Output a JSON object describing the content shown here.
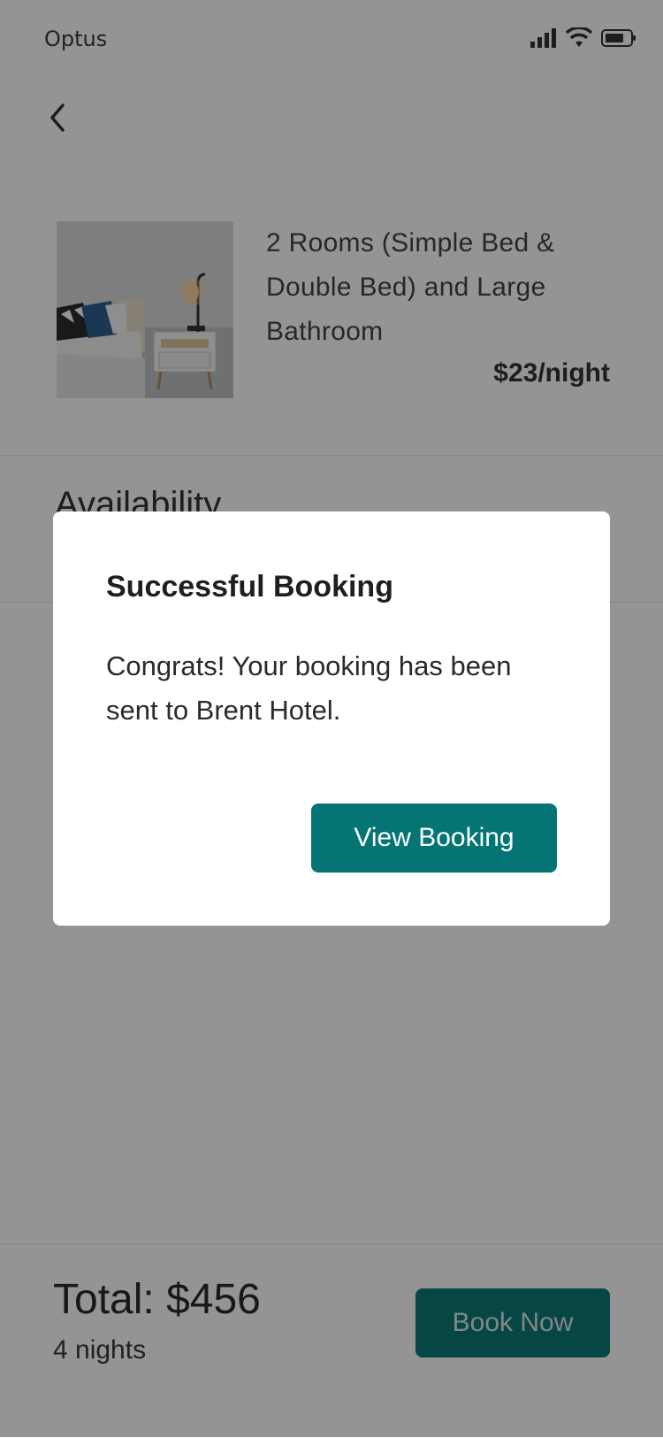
{
  "status_bar": {
    "carrier": "Optus",
    "icons": [
      "signal-icon",
      "wifi-icon",
      "battery-icon"
    ]
  },
  "header": {
    "back_icon": "chevron-left-icon"
  },
  "room": {
    "title": "2 Rooms (Simple Bed & Double Bed) and Large Bathroom",
    "price": "$23/night",
    "photo": "bedroom-photo"
  },
  "availability": {
    "heading": "Availability"
  },
  "footer": {
    "total": "Total: $456",
    "nights": "4 nights",
    "book_now_label": "Book Now"
  },
  "dialog": {
    "title": "Successful Booking",
    "message": "Congrats! Your booking has been sent to Brent Hotel.",
    "view_booking_label": "View Booking"
  },
  "colors": {
    "accent": "#047574",
    "overlay": "rgba(0,0,0,0.42)",
    "text": "#222222"
  }
}
